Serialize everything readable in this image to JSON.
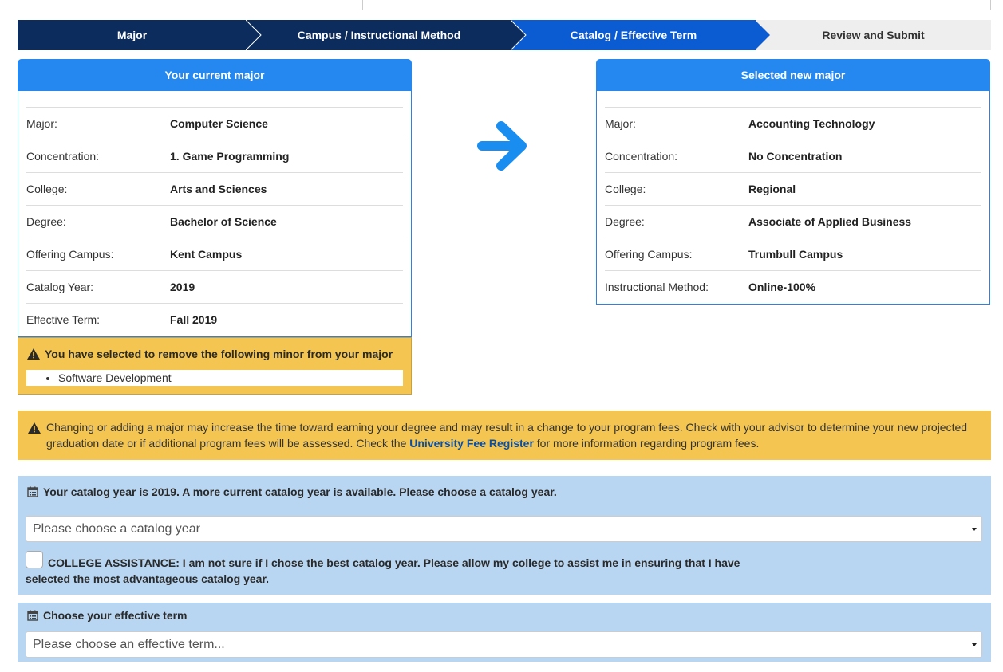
{
  "stepper": {
    "steps": [
      {
        "label": "Major"
      },
      {
        "label": "Campus  / Instructional Method"
      },
      {
        "label": "Catalog / Effective Term"
      },
      {
        "label": "Review and Submit"
      }
    ]
  },
  "current_major": {
    "title": "Your current major",
    "rows": [
      {
        "label": "Major:",
        "value": "Computer Science"
      },
      {
        "label": "Concentration:",
        "value": "1.  Game Programming"
      },
      {
        "label": "College:",
        "value": "Arts and Sciences"
      },
      {
        "label": "Degree:",
        "value": "Bachelor of Science"
      },
      {
        "label": "Offering Campus:",
        "value": "Kent Campus"
      },
      {
        "label": "Catalog Year:",
        "value": "2019"
      },
      {
        "label": "Effective Term:",
        "value": "Fall 2019"
      }
    ],
    "minor_warning": "You have selected to remove the following minor from your major",
    "minors": [
      "Software Development"
    ]
  },
  "new_major": {
    "title": "Selected new major",
    "rows": [
      {
        "label": "Major:",
        "value": "Accounting Technology"
      },
      {
        "label": "Concentration:",
        "value": "No Concentration"
      },
      {
        "label": "College:",
        "value": "Regional"
      },
      {
        "label": "Degree:",
        "value": "Associate of Applied Business"
      },
      {
        "label": "Offering Campus:",
        "value": "Trumbull Campus"
      },
      {
        "label": "Instructional Method:",
        "value": "Online-100%"
      }
    ]
  },
  "notice": {
    "text_before": "Changing or adding a major may increase the time toward earning your degree and may result in a change to your program fees. Check with your advisor to determine your new projected graduation date or if additional program fees will be assessed. Check the ",
    "link": "University Fee Register",
    "text_after": " for more information regarding program fees."
  },
  "catalog": {
    "title": "Your catalog year is 2019.  A more current catalog year is available. Please choose a catalog year.",
    "select_value": "Please choose a catalog year",
    "assist_text": "COLLEGE ASSISTANCE: I am not sure if I chose the best catalog year. Please allow my college to assist me in ensuring that I have selected the most advantageous catalog year."
  },
  "term": {
    "title": "Choose your effective term",
    "select_value": "Please choose an effective term..."
  },
  "colors": {
    "navy": "#0d2c5e",
    "active_blue": "#0b5bd3",
    "panel_blue": "#2488f0",
    "warning_yellow": "#f4c550",
    "section_blue": "#b8d6f2"
  }
}
